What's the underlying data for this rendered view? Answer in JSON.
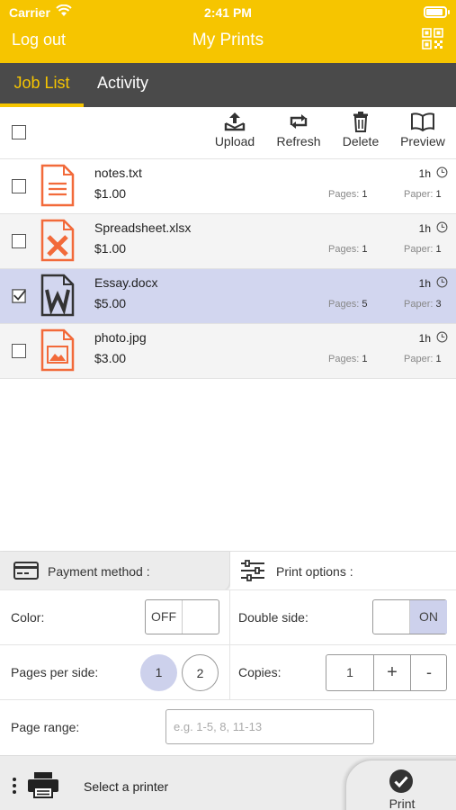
{
  "status": {
    "carrier": "Carrier",
    "time": "2:41 PM"
  },
  "header": {
    "logout": "Log out",
    "title": "My Prints"
  },
  "tabs": [
    {
      "label": "Job List",
      "active": true
    },
    {
      "label": "Activity",
      "active": false
    }
  ],
  "toolbar": {
    "upload": "Upload",
    "refresh": "Refresh",
    "delete": "Delete",
    "preview": "Preview"
  },
  "jobs": [
    {
      "name": "notes.txt",
      "price": "$1.00",
      "age": "1h",
      "pages_label": "Pages:",
      "pages": "1",
      "paper_label": "Paper:",
      "paper": "1",
      "type_icon": "text-file-icon",
      "selected": false
    },
    {
      "name": "Spreadsheet.xlsx",
      "price": "$1.00",
      "age": "1h",
      "pages_label": "Pages:",
      "pages": "1",
      "paper_label": "Paper:",
      "paper": "1",
      "type_icon": "excel-file-icon",
      "selected": false
    },
    {
      "name": "Essay.docx",
      "price": "$5.00",
      "age": "1h",
      "pages_label": "Pages:",
      "pages": "5",
      "paper_label": "Paper:",
      "paper": "3",
      "type_icon": "word-file-icon",
      "selected": true
    },
    {
      "name": "photo.jpg",
      "price": "$3.00",
      "age": "1h",
      "pages_label": "Pages:",
      "pages": "1",
      "paper_label": "Paper:",
      "paper": "1",
      "type_icon": "image-file-icon",
      "selected": false
    }
  ],
  "panel": {
    "payment_tab": "Payment method :",
    "options_tab": "Print options :"
  },
  "options": {
    "color_label": "Color:",
    "color_value": "OFF",
    "double_side_label": "Double side:",
    "double_side_value": "ON",
    "pages_per_side_label": "Pages per side:",
    "pages_per_side_opts": [
      "1",
      "2"
    ],
    "pages_per_side_selected": "1",
    "copies_label": "Copies:",
    "copies_value": "1",
    "copies_plus": "+",
    "copies_minus": "-",
    "page_range_label": "Page range:",
    "page_range_placeholder": "e.g. 1-5, 8, 11-13",
    "page_range_value": ""
  },
  "printer": {
    "select_label": "Select a printer",
    "print_button": "Print"
  },
  "colors": {
    "brand_yellow": "#f6c500",
    "tab_bar": "#4a4a4a",
    "selected_row": "#d2d6ef",
    "file_icon_orange": "#f26a3a",
    "toggle_on": "#cdd1ec"
  }
}
